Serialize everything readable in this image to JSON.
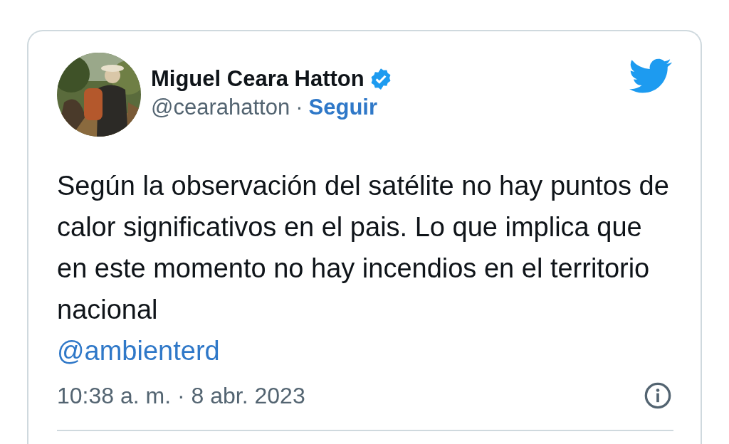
{
  "tweet": {
    "author": {
      "name": "Miguel Ceara Hatton",
      "verified": true,
      "handle": "@cearahatton",
      "separator": "·",
      "follow": "Seguir"
    },
    "text": "Según la observación del satélite no hay puntos de calor significativos en el pais. Lo que implica que en este momento no hay incendios en el territorio nacional",
    "mention": "@ambienterd",
    "timestamp": "10:38 a. m. · 8 abr. 2023"
  }
}
